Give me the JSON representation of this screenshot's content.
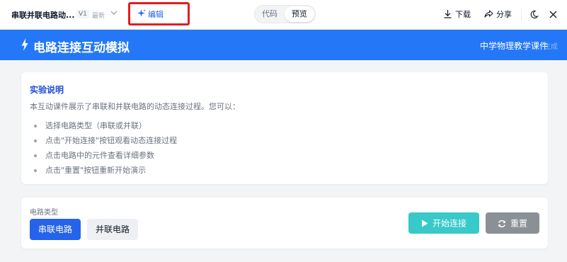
{
  "topbar": {
    "doc_title": "串联并联电路动...",
    "version": "V1",
    "version_tag": "最新",
    "edit_label": "编辑",
    "tabs": [
      {
        "label": "代码",
        "selected": false
      },
      {
        "label": "预览",
        "selected": true
      }
    ],
    "download_label": "下载",
    "share_label": "分享",
    "icons": [
      "chevron-down-icon",
      "sparkle-icon",
      "download-icon",
      "share-icon",
      "moon-icon",
      "close-icon"
    ]
  },
  "header": {
    "title": "电路连接互动模拟",
    "subtitle": "中学物理教学课件",
    "subtitle_overlap": "生成",
    "background": "#2478f7"
  },
  "info": {
    "title": "实验说明",
    "description": "本互动课件展示了串联和并联电路的动态连接过程。您可以：",
    "items": [
      "选择电路类型（串联或并联）",
      "点击\"开始连接\"按钮观看动态连接过程",
      "点击电路中的元件查看详细参数",
      "点击\"重置\"按钮重新开始演示"
    ]
  },
  "controls": {
    "circuit_type_label": "电路类型",
    "series_label": "串联电路",
    "parallel_label": "并联电路",
    "selected_type": "串联电路",
    "start_label": "开始连接",
    "reset_label": "重置"
  },
  "colors": {
    "accent": "#2563eb",
    "start": "#38c9c9",
    "reset": "#8a9096",
    "edit_highlight": "#e31d1d"
  }
}
